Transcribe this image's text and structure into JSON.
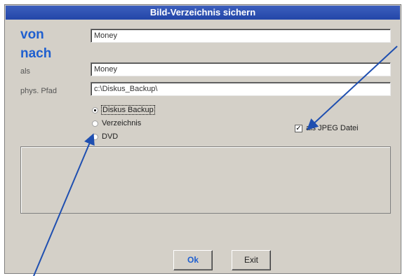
{
  "window": {
    "title": "Bild-Verzeichnis sichern"
  },
  "labels": {
    "von": "von",
    "nach": "nach",
    "als": "als",
    "pfad": "phys. Pfad"
  },
  "fields": {
    "von_value": "Money",
    "als_value": "Money",
    "pfad_value": "c:\\Diskus_Backup\\"
  },
  "target_options": [
    {
      "label": "Diskus Backup",
      "selected": true
    },
    {
      "label": "Verzeichnis",
      "selected": false
    },
    {
      "label": "DVD",
      "selected": false
    }
  ],
  "jpeg_option": {
    "label": "als JPEG Datei",
    "checked": true
  },
  "buttons": {
    "ok": "Ok",
    "exit": "Exit"
  },
  "colors": {
    "title_bar": "#2346a8",
    "accent_label": "#1f5fcf",
    "dialog_bg": "#d4d0c8",
    "arrow": "#1f4fb0"
  }
}
